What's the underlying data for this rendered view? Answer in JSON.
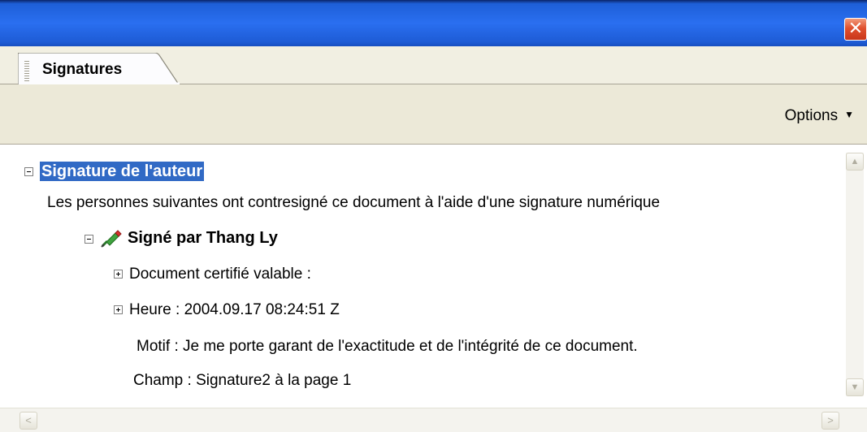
{
  "window": {
    "close_glyph": "✕"
  },
  "tabs": [
    {
      "label": "Signatures"
    }
  ],
  "toolbar": {
    "options_label": "Options",
    "options_caret": "▼"
  },
  "tree": {
    "root_label": "Signature de l'auteur",
    "description": "Les personnes suivantes ont contresigné ce document à l'aide d'une signature numérique",
    "signer_label": "Signé par Thang Ly",
    "details": {
      "certified": "Document certifié valable :",
      "time": "Heure : 2004.09.17 08:24:51 Z",
      "reason": "Motif : Je me porte garant de l'exactitude et de l'intégrité de ce document.",
      "field": "Champ : Signature2 à la page 1"
    }
  },
  "scrollbars": {
    "up_glyph": "▲",
    "down_glyph": "▼",
    "left_glyph": "<",
    "right_glyph": ">"
  },
  "icons": {
    "close": "close-icon",
    "signer": "pen-signature-icon",
    "grip": "tab-grip-icon"
  },
  "colors": {
    "titlebar": "#2a6ff0",
    "selection": "#316ac5",
    "close_button": "#e0502e",
    "panel": "#ece9d8"
  }
}
